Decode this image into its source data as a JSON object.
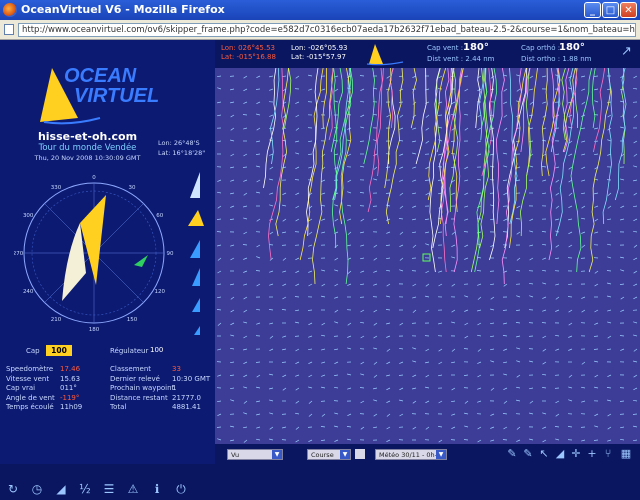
{
  "window": {
    "title": "OceanVirtuel V6 - Mozilla Firefox"
  },
  "browser": {
    "url": "http://www.oceanvirtuel.com/ov6/skipper_frame.php?code=e582d7c0316ecb07aeda17b2632f71ebad_bateau-2.5-2&course=1&nom_bateau=hisse-et-oh.com&pass=...a=H"
  },
  "logo": {
    "line1": "OCEAN",
    "line2": "VIRTUEL"
  },
  "boat": {
    "name": "hisse-et-oh.com",
    "race": "Tour du monde Vendée",
    "date": "Thu, 20 Nov 2008 10:30:09 GMT",
    "lon": "Lon: 26°48'S",
    "lat": "Lat: 16°18'28\""
  },
  "compass": {
    "labels": [
      "0",
      "30",
      "60",
      "90",
      "120",
      "150",
      "180",
      "210",
      "240",
      "270",
      "300",
      "330"
    ]
  },
  "controls": {
    "cap_label": "Cap",
    "cap_value": "100",
    "reg_label": "Régulateur",
    "reg_value": "100"
  },
  "stats_left": [
    {
      "k": "Speedomètre",
      "v": "17.46",
      "red": true
    },
    {
      "k": "Vitesse vent",
      "v": "15.63",
      "red": false
    },
    {
      "k": "Cap vrai",
      "v": "011°",
      "red": false
    },
    {
      "k": "Angle de vent",
      "v": "-119°",
      "red": true
    },
    {
      "k": "Temps écoulé",
      "v": "11h09",
      "red": false
    }
  ],
  "stats_right": [
    {
      "k": "Classement",
      "v": "33",
      "red": true
    },
    {
      "k": "Dernier relevé",
      "v": "10:30 GMT",
      "red": false
    },
    {
      "k": "Prochain waypoint",
      "v": "1",
      "red": false
    },
    {
      "k": "Distance restant",
      "v": "21777.0",
      "red": false
    },
    {
      "k": "Total",
      "v": "4881.41",
      "red": false
    }
  ],
  "info": {
    "lon_red": "Lon: 026°45.53",
    "lat_red": "Lat: -015°16.88",
    "lon_white": "Lon: -026°05.93",
    "lat_white": "Lat: -015°57.97",
    "cap_label": "Cap vent :",
    "cap_value": "180°",
    "cap2_label": "Cap orthó :",
    "cap2_value": "180°",
    "dist_label": "Dist vent : 2.44 nm",
    "dist2_label": "Dist ortho : 1.88 nm"
  },
  "bottom": {
    "sel1": "Vu",
    "sel2": "Course",
    "sel3": "Météo 30/11 - 0h-06"
  },
  "colors": {
    "accent": "#ffd020",
    "map_bg": "#3d3d98",
    "panel": "#0c1a72"
  }
}
